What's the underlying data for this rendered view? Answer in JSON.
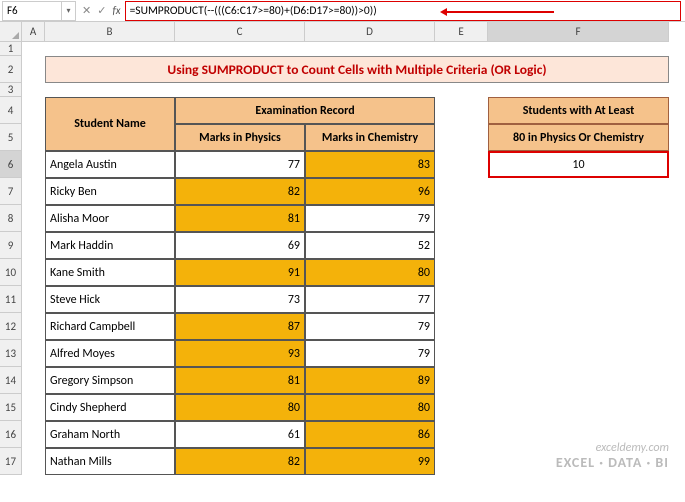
{
  "cellref": "F6",
  "formula": "=SUMPRODUCT(--(((C6:C17>=80)+(D6:D17>=80))>0))",
  "title": "Using SUMPRODUCT to Count Cells with Multiple Criteria (OR Logic)",
  "headers": {
    "student": "Student Name",
    "exam": "Examination Record",
    "physics": "Marks in Physics",
    "chemistry": "Marks in Chemistry"
  },
  "result_header1": "Students with At Least",
  "result_header2": "80 in Physics Or Chemistry",
  "result_value": "10",
  "cols": [
    "A",
    "B",
    "C",
    "D",
    "E",
    "F"
  ],
  "rows": [
    "1",
    "2",
    "3",
    "4",
    "5",
    "6",
    "7",
    "8",
    "9",
    "10",
    "11",
    "12",
    "13",
    "14",
    "15",
    "16",
    "17"
  ],
  "students": [
    {
      "name": "Angela Austin",
      "p": "77",
      "c": "83",
      "hp": false,
      "hc": true
    },
    {
      "name": "Ricky Ben",
      "p": "82",
      "c": "96",
      "hp": true,
      "hc": true
    },
    {
      "name": "Alisha Moor",
      "p": "81",
      "c": "79",
      "hp": true,
      "hc": false
    },
    {
      "name": "Mark Haddin",
      "p": "69",
      "c": "52",
      "hp": false,
      "hc": false
    },
    {
      "name": "Kane Smith",
      "p": "91",
      "c": "80",
      "hp": true,
      "hc": true
    },
    {
      "name": "Steve Hick",
      "p": "73",
      "c": "77",
      "hp": false,
      "hc": false
    },
    {
      "name": "Richard Campbell",
      "p": "87",
      "c": "79",
      "hp": true,
      "hc": false
    },
    {
      "name": "Alfred Moyes",
      "p": "93",
      "c": "79",
      "hp": true,
      "hc": false
    },
    {
      "name": "Gregory Simpson",
      "p": "81",
      "c": "89",
      "hp": true,
      "hc": true
    },
    {
      "name": "Cindy Shepherd",
      "p": "80",
      "c": "80",
      "hp": true,
      "hc": true
    },
    {
      "name": "Graham North",
      "p": "61",
      "c": "86",
      "hp": false,
      "hc": true
    },
    {
      "name": "Nathan Mills",
      "p": "82",
      "c": "99",
      "hp": true,
      "hc": true
    }
  ],
  "watermark": {
    "brand": "exceldemy",
    "tag": ".com",
    "sub": "EXCEL · DATA · BI"
  },
  "chart_data": {
    "type": "table",
    "title": "Using SUMPRODUCT to Count Cells with Multiple Criteria (OR Logic)",
    "columns": [
      "Student Name",
      "Marks in Physics",
      "Marks in Chemistry"
    ],
    "rows": [
      [
        "Angela Austin",
        77,
        83
      ],
      [
        "Ricky Ben",
        82,
        96
      ],
      [
        "Alisha Moor",
        81,
        79
      ],
      [
        "Mark Haddin",
        69,
        52
      ],
      [
        "Kane Smith",
        91,
        80
      ],
      [
        "Steve Hick",
        73,
        77
      ],
      [
        "Richard Campbell",
        87,
        79
      ],
      [
        "Alfred Moyes",
        93,
        79
      ],
      [
        "Gregory Simpson",
        81,
        89
      ],
      [
        "Cindy Shepherd",
        80,
        80
      ],
      [
        "Graham North",
        61,
        86
      ],
      [
        "Nathan Mills",
        82,
        99
      ]
    ],
    "summary": {
      "label": "Students with At Least 80 in Physics Or Chemistry",
      "value": 10
    }
  }
}
